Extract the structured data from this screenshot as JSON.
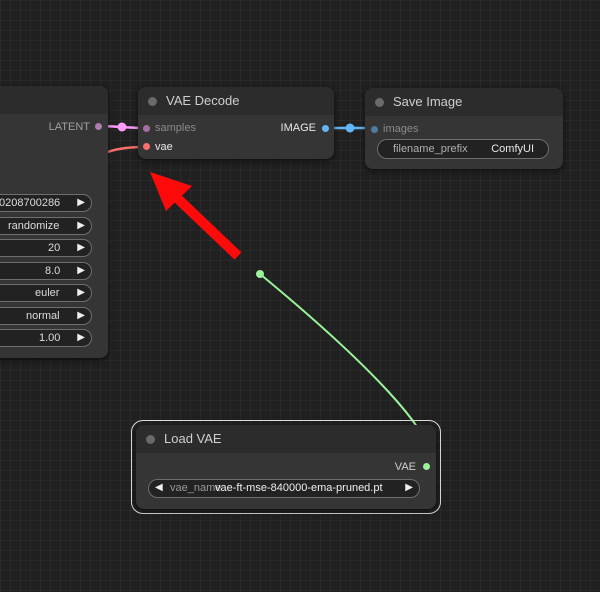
{
  "ksampler": {
    "output_latent": "LATENT",
    "widgets": [
      "0208700286",
      "randomize",
      "20",
      "8.0",
      "euler",
      "normal",
      "1.00"
    ]
  },
  "vae_decode": {
    "title": "VAE Decode",
    "input_samples": "samples",
    "input_vae": "vae",
    "output_image": "IMAGE"
  },
  "save_image": {
    "title": "Save Image",
    "input_images": "images",
    "widget_name": "filename_prefix",
    "widget_value": "ComfyUI"
  },
  "load_vae": {
    "title": "Load VAE",
    "output_vae": "VAE",
    "widget_name": "vae_name",
    "widget_value": "vae-ft-mse-840000-ema-pruned.pt"
  },
  "colors": {
    "latent_link": "#ff9cf9",
    "image_link": "#64b5f6",
    "vae_link": "#ff6e6e",
    "vae_drag_link": "#9af29a",
    "annotation_arrow": "#ff0a0a"
  },
  "icons": [
    "arrow-right-icon",
    "arrow-left-icon",
    "annotation-arrow-icon"
  ]
}
